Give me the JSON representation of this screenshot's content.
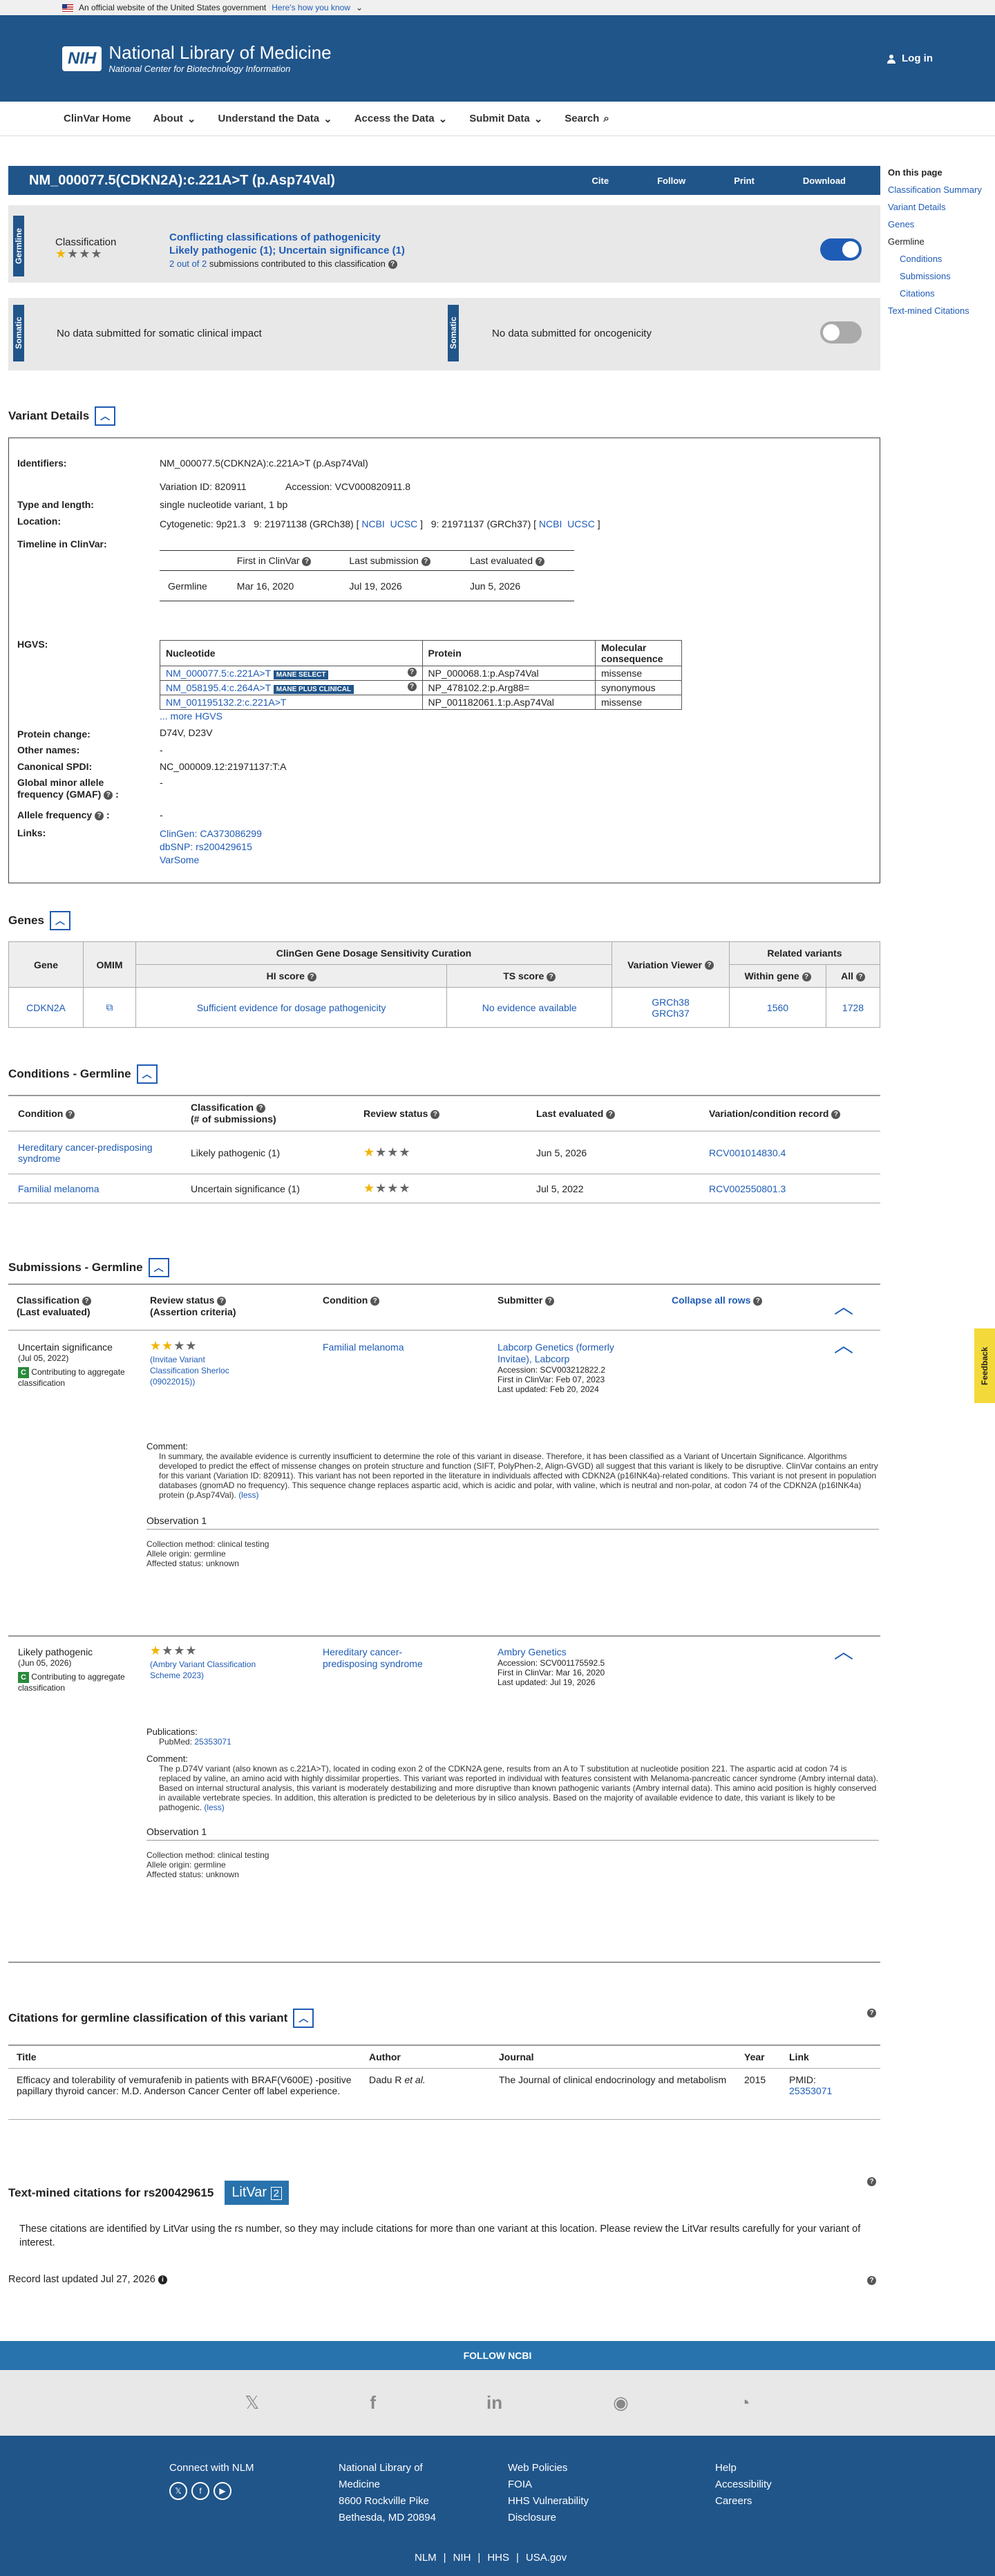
{
  "gov_banner": {
    "text": "An official website of the United States government",
    "link": "Here's how you know"
  },
  "header": {
    "logo": "NIH",
    "title": "National Library of Medicine",
    "subtitle": "National Center for Biotechnology Information",
    "login": "Log in"
  },
  "nav": [
    "ClinVar Home",
    "About",
    "Understand the Data",
    "Access the Data",
    "Submit Data",
    "Search"
  ],
  "title": {
    "text": "NM_000077.5(CDKN2A):c.221A>T (p.Asp74Val)",
    "actions": [
      "Cite",
      "Follow",
      "Print",
      "Download"
    ]
  },
  "germline": {
    "tab": "Germline",
    "label": "Classification",
    "status": "Conflicting classifications of pathogenicity",
    "detail": "Likely pathogenic (1); Uncertain significance (1)",
    "submissions_prefix": "2 out of 2",
    "submissions_suffix": "submissions contributed to this classification"
  },
  "somatic": {
    "tab": "Somatic",
    "left": "No data submitted for somatic clinical impact",
    "right": "No data submitted for oncogenicity"
  },
  "on_this_page": {
    "heading": "On this page",
    "items": [
      "Classification Summary",
      "Variant Details",
      "Genes",
      "Germline",
      "Conditions",
      "Submissions",
      "Citations",
      "Text-mined Citations"
    ]
  },
  "variant_details": {
    "heading": "Variant Details",
    "identifiers_label": "Identifiers:",
    "identifiers": "NM_000077.5(CDKN2A):c.221A>T (p.Asp74Val)",
    "variation_id": "Variation ID: 820911",
    "accession": "Accession: VCV000820911.8",
    "type_label": "Type and length:",
    "type": "single nucleotide variant, 1 bp",
    "location_label": "Location:",
    "cytogenetic": "Cytogenetic: 9p21.3",
    "grch38": "9: 21971138 (GRCh38) [",
    "grch37": "9: 21971137 (GRCh37) [",
    "ncbi": "NCBI",
    "ucsc": "UCSC",
    "bracket": "]",
    "timeline_label": "Timeline in ClinVar:",
    "timeline_headers": [
      "First in ClinVar",
      "Last submission",
      "Last evaluated"
    ],
    "timeline_row": [
      "Germline",
      "Mar 16, 2020",
      "Jul 19, 2026",
      "Jun 5, 2026"
    ],
    "hgvs_label": "HGVS:",
    "hgvs_headers": [
      "Nucleotide",
      "Protein",
      "Molecular consequence"
    ],
    "hgvs_rows": [
      {
        "nuc": "NM_000077.5:c.221A>T",
        "badge": "MANE SELECT",
        "protein": "NP_000068.1:p.Asp74Val",
        "cons": "missense"
      },
      {
        "nuc": "NM_058195.4:c.264A>T",
        "badge": "MANE PLUS CLINICAL",
        "protein": "NP_478102.2:p.Arg88=",
        "cons": "synonymous"
      },
      {
        "nuc": "NM_001195132.2:c.221A>T",
        "badge": "",
        "protein": "NP_001182061.1:p.Asp74Val",
        "cons": "missense"
      }
    ],
    "more_hgvs": "... more HGVS",
    "protein_change_label": "Protein change:",
    "protein_change": "D74V, D23V",
    "other_names_label": "Other names:",
    "other_names": "-",
    "spdi_label": "Canonical SPDI:",
    "spdi": "NC_000009.12:21971137:T:A",
    "gmaf_label": "Global minor allele frequency (GMAF)",
    "gmaf": "-",
    "af_label": "Allele frequency",
    "af": "-",
    "links_label": "Links:",
    "links": [
      "ClinGen: CA373086299",
      "dbSNP: rs200429615",
      "VarSome"
    ]
  },
  "genes": {
    "heading": "Genes",
    "group1": "ClinGen Gene Dosage Sensitivity Curation",
    "group2": "Related variants",
    "headers": [
      "Gene",
      "OMIM",
      "HI score",
      "TS score",
      "Variation Viewer",
      "Within gene",
      "All"
    ],
    "row": {
      "gene": "CDKN2A",
      "hi": "Sufficient evidence for dosage pathogenicity",
      "ts": "No evidence available",
      "vv1": "GRCh38",
      "vv2": "GRCh37",
      "within": "1560",
      "all": "1728"
    }
  },
  "conditions": {
    "heading": "Conditions - Germline",
    "headers": [
      "Condition",
      "Classification",
      "(# of submissions)",
      "Review status",
      "Last evaluated",
      "Variation/condition record"
    ],
    "rows": [
      {
        "condition": "Hereditary cancer-predisposing syndrome",
        "classification": "Likely pathogenic (1)",
        "last": "Jun 5, 2026",
        "record": "RCV001014830.4"
      },
      {
        "condition": "Familial melanoma",
        "classification": "Uncertain significance (1)",
        "last": "Jul 5, 2022",
        "record": "RCV002550801.3"
      }
    ]
  },
  "submissions": {
    "heading": "Submissions - Germline",
    "headers": [
      "Classification",
      "(Last evaluated)",
      "Review status",
      "(Assertion criteria)",
      "Condition",
      "Submitter",
      "Collapse all rows"
    ],
    "rows": [
      {
        "classification": "Uncertain significance",
        "date": "(Jul 05, 2022)",
        "contrib": "Contributing to aggregate classification",
        "criteria": "(Invitae Variant Classification Sherloc (09022015))",
        "condition": "Familial melanoma",
        "submitter": "Labcorp Genetics (formerly Invitae), Labcorp",
        "accession": "Accession: SCV003212822.2",
        "first": "First in ClinVar: Feb 07, 2023",
        "updated": "Last updated: Feb 20, 2024",
        "comment_label": "Comment:",
        "comment": "In summary, the available evidence is currently insufficient to determine the role of this variant in disease. Therefore, it has been classified as a Variant of Uncertain Significance. Algorithms developed to predict the effect of missense changes on protein structure and function (SIFT, PolyPhen-2, Align-GVGD) all suggest that this variant is likely to be disruptive. ClinVar contains an entry for this variant (Variation ID: 820911). This variant has not been reported in the literature in individuals affected with CDKN2A (p16INK4a)-related conditions. This variant is not present in population databases (gnomAD no frequency). This sequence change replaces aspartic acid, which is acidic and polar, with valine, which is neutral and non-polar, at codon 74 of the CDKN2A (p16INK4a) protein (p.Asp74Val).",
        "less": "(less)",
        "obs": "Observation 1",
        "method": "Collection method: clinical testing",
        "origin": "Allele origin: germline",
        "affected": "Affected status: unknown"
      },
      {
        "classification": "Likely pathogenic",
        "date": "(Jun 05, 2026)",
        "contrib": "Contributing to aggregate classification",
        "criteria": "(Ambry Variant Classification Scheme 2023)",
        "condition": "Hereditary cancer-predisposing syndrome",
        "submitter": "Ambry Genetics",
        "accession": "Accession: SCV001175592.5",
        "first": "First in ClinVar: Mar 16, 2020",
        "updated": "Last updated: Jul 19, 2026",
        "pub_label": "Publications:",
        "pubmed": "PubMed: 25353071",
        "comment_label": "Comment:",
        "comment": "The p.D74V variant (also known as c.221A>T), located in coding exon 2 of the CDKN2A gene, results from an A to T substitution at nucleotide position 221. The aspartic acid at codon 74 is replaced by valine, an amino acid with highly dissimilar properties. This variant was reported in individual with features consistent with Melanoma-pancreatic cancer syndrome (Ambry internal data). Based on internal structural analysis, this variant is moderately destabilizing and more disruptive than known pathogenic variants (Ambry internal data). This amino acid position is highly conserved in available vertebrate species. In addition, this alteration is predicted to be deleterious by in silico analysis. Based on the majority of available evidence to date, this variant is likely to be pathogenic.",
        "less": "(less)",
        "obs": "Observation 1",
        "method": "Collection method: clinical testing",
        "origin": "Allele origin: germline",
        "affected": "Affected status: unknown"
      }
    ]
  },
  "citations": {
    "heading": "Citations for germline classification of this variant",
    "headers": [
      "Title",
      "Author",
      "Journal",
      "Year",
      "Link"
    ],
    "row": {
      "title": "Efficacy and tolerability of vemurafenib in patients with BRAF(V600E) -positive papillary thyroid cancer: M.D. Anderson Cancer Center off label experience.",
      "author": "Dadu R",
      "etal": "et al.",
      "journal": "The Journal of clinical endocrinology and metabolism",
      "year": "2015",
      "pmid": "PMID:",
      "pmid_num": "25353071"
    }
  },
  "textmined": {
    "heading": "Text-mined citations for rs200429615",
    "litvar": "LitVar",
    "litvar2": "2",
    "note": "These citations are identified by LitVar using the rs number, so they may include citations for more than one variant at this location. Please review the LitVar results carefully for your variant of interest."
  },
  "record_updated": "Record last updated Jul 27, 2026",
  "feedback": "Feedback",
  "footer": {
    "follow": "FOLLOW NCBI",
    "connect": "Connect with NLM",
    "address": [
      "National Library of",
      "Medicine",
      "8600 Rockville Pike",
      "Bethesda, MD 20894"
    ],
    "col3": [
      "Web Policies",
      "FOIA",
      "HHS Vulnerability",
      "Disclosure"
    ],
    "col4": [
      "Help",
      "Accessibility",
      "Careers"
    ],
    "bottom": [
      "NLM",
      "NIH",
      "HHS",
      "USA.gov"
    ]
  }
}
